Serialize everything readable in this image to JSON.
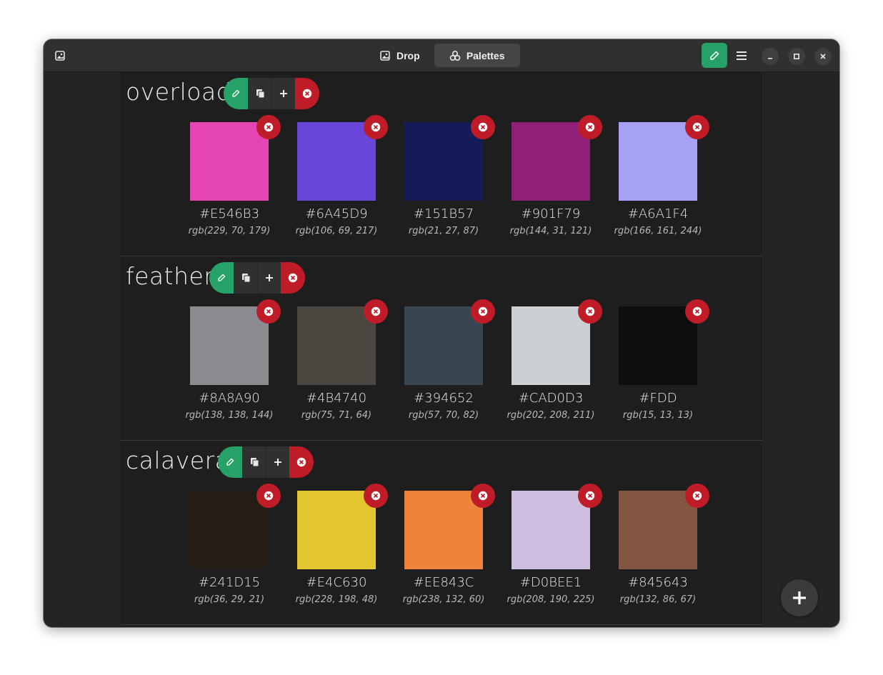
{
  "header": {
    "tabs": [
      {
        "label": "Drop",
        "icon": "image-icon",
        "active": false
      },
      {
        "label": "Palettes",
        "icon": "palettes-icon",
        "active": true
      }
    ],
    "picker_icon": "color-picker-icon",
    "menu_icon": "hamburger-menu-icon"
  },
  "colors": {
    "accent": "#26a269",
    "destructive": "#c01c28"
  },
  "palettes": [
    {
      "name": "overload",
      "swatches": [
        {
          "hex": "#E546B3",
          "rgb": "rgb(229, 70, 179)"
        },
        {
          "hex": "#6A45D9",
          "rgb": "rgb(106, 69, 217)"
        },
        {
          "hex": "#151B57",
          "rgb": "rgb(21, 27, 87)"
        },
        {
          "hex": "#901F79",
          "rgb": "rgb(144, 31, 121)"
        },
        {
          "hex": "#A6A1F4",
          "rgb": "rgb(166, 161, 244)"
        }
      ]
    },
    {
      "name": "feather",
      "swatches": [
        {
          "hex": "#8A8A90",
          "rgb": "rgb(138, 138, 144)"
        },
        {
          "hex": "#4B4740",
          "rgb": "rgb(75, 71, 64)"
        },
        {
          "hex": "#394652",
          "rgb": "rgb(57, 70, 82)"
        },
        {
          "hex": "#CAD0D3",
          "rgb": "rgb(202, 208, 211)"
        },
        {
          "hex": "#FDD",
          "rgb": "rgb(15, 13, 13)",
          "fill": "#0F0D0D"
        }
      ]
    },
    {
      "name": "calavera",
      "swatches": [
        {
          "hex": "#241D15",
          "rgb": "rgb(36, 29, 21)"
        },
        {
          "hex": "#E4C630",
          "rgb": "rgb(228, 198, 48)"
        },
        {
          "hex": "#EE843C",
          "rgb": "rgb(238, 132, 60)"
        },
        {
          "hex": "#D0BEE1",
          "rgb": "rgb(208, 190, 225)"
        },
        {
          "hex": "#845643",
          "rgb": "rgb(132, 86, 67)"
        }
      ]
    }
  ],
  "fab_icon": "plus-icon"
}
